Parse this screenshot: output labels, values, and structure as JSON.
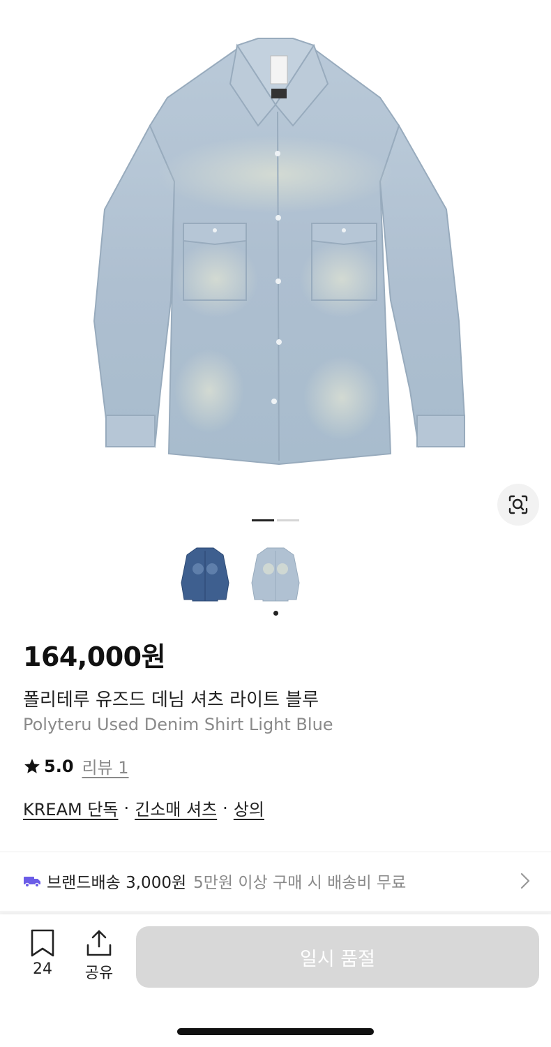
{
  "product": {
    "price": "164,000원",
    "name_ko": "폴리테루 유즈드 데님 셔츠 라이트 블루",
    "name_en": "Polyteru Used Denim Shirt Light Blue",
    "rating": "5.0",
    "review_link": "리뷰 1",
    "categories": [
      "KREAM 단독",
      "긴소매 셔츠",
      "상의"
    ],
    "separator": "·"
  },
  "gallery": {
    "main_image": "light-blue-denim-shirt",
    "thumbnails": [
      "dark-blue-denim-shirt",
      "light-blue-denim-shirt"
    ],
    "icons": {
      "lens": "image-search-icon"
    }
  },
  "shipping": {
    "label": "브랜드배송 3,000원",
    "note": "5만원 이상 구매 시 배송비 무료",
    "icon": "truck-icon",
    "icon_color": "#6b5ce7"
  },
  "bottom_bar": {
    "bookmark_count": "24",
    "share_label": "공유",
    "sold_out_label": "일시 품절",
    "sold_out_color": "#d8d8d8"
  }
}
